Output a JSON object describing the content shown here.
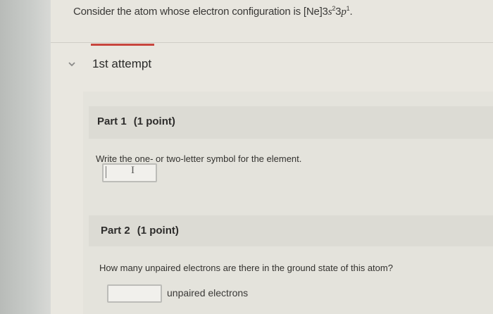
{
  "question": {
    "prefix": "Consider the atom whose electron configuration is [Ne]3",
    "s_letter": "s",
    "s_exp": "2",
    "mid": "3",
    "p_letter": "p",
    "p_exp": "1",
    "suffix": "."
  },
  "attempt": {
    "label": "1st attempt",
    "icon": "chevron-down-icon"
  },
  "part1": {
    "title": "Part 1",
    "points": "(1 point)",
    "prompt": "Write the one- or two-letter symbol for the element.",
    "input_value": ""
  },
  "part2": {
    "title": "Part 2",
    "points": "(1 point)",
    "prompt": "How many unpaired electrons are there in the ground state of this atom?",
    "input_value": "",
    "unit_label": "unpaired electrons"
  },
  "colors": {
    "accent_underline": "#c8463e"
  }
}
